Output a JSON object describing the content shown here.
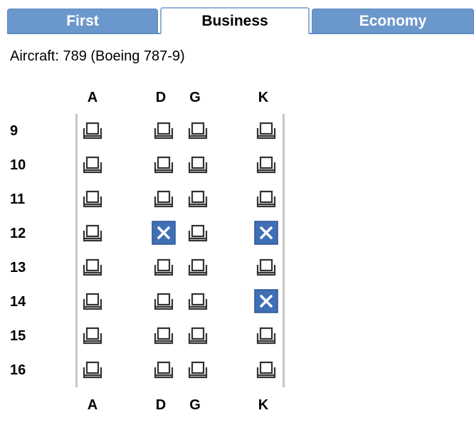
{
  "tabs": [
    {
      "label": "First",
      "active": false
    },
    {
      "label": "Business",
      "active": true
    },
    {
      "label": "Economy",
      "active": false
    }
  ],
  "aircraft_text": "Aircraft: 789 (Boeing 787-9)",
  "columns": [
    "A",
    "D",
    "G",
    "K"
  ],
  "rows": [
    {
      "row": "9",
      "seats": {
        "A": "available",
        "D": "available",
        "G": "available",
        "K": "available"
      }
    },
    {
      "row": "10",
      "seats": {
        "A": "available",
        "D": "available",
        "G": "available",
        "K": "available"
      }
    },
    {
      "row": "11",
      "seats": {
        "A": "available",
        "D": "available",
        "G": "available",
        "K": "available"
      }
    },
    {
      "row": "12",
      "seats": {
        "A": "available",
        "D": "occupied",
        "G": "available",
        "K": "occupied"
      }
    },
    {
      "row": "13",
      "seats": {
        "A": "available",
        "D": "available",
        "G": "available",
        "K": "available"
      }
    },
    {
      "row": "14",
      "seats": {
        "A": "available",
        "D": "available",
        "G": "available",
        "K": "occupied"
      }
    },
    {
      "row": "15",
      "seats": {
        "A": "available",
        "D": "available",
        "G": "available",
        "K": "available"
      }
    },
    {
      "row": "16",
      "seats": {
        "A": "available",
        "D": "available",
        "G": "available",
        "K": "available"
      }
    }
  ],
  "colors": {
    "tab_bg": "#6b98cc",
    "occupied": "#3f6fb5",
    "seat_outline": "#333333"
  }
}
